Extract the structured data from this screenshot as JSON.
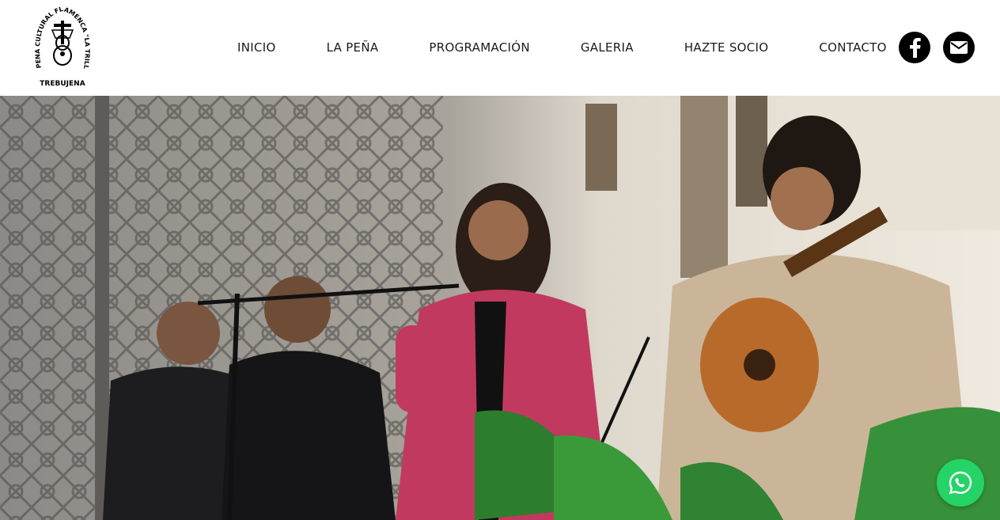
{
  "logo": {
    "text_arc": "PEÑA CULTURAL FLAMENCA \"LA TRILLA\"",
    "text_bottom": "TREBUJENA"
  },
  "nav": {
    "items": [
      {
        "label": "INICIO"
      },
      {
        "label": "LA PEÑA"
      },
      {
        "label": "PROGRAMACIÓN"
      },
      {
        "label": "GALERIA"
      },
      {
        "label": "HAZTE SOCIO"
      },
      {
        "label": "CONTACTO"
      }
    ]
  },
  "social": {
    "facebook_icon": "facebook-icon",
    "mail_icon": "mail-icon"
  },
  "hero": {
    "image_subject": "flamenco-performance-photo"
  },
  "floating": {
    "whatsapp_icon": "whatsapp-icon"
  },
  "colors": {
    "whatsapp": "#25d366",
    "social_bg": "#000000",
    "nav_text": "#1a1a1a"
  }
}
